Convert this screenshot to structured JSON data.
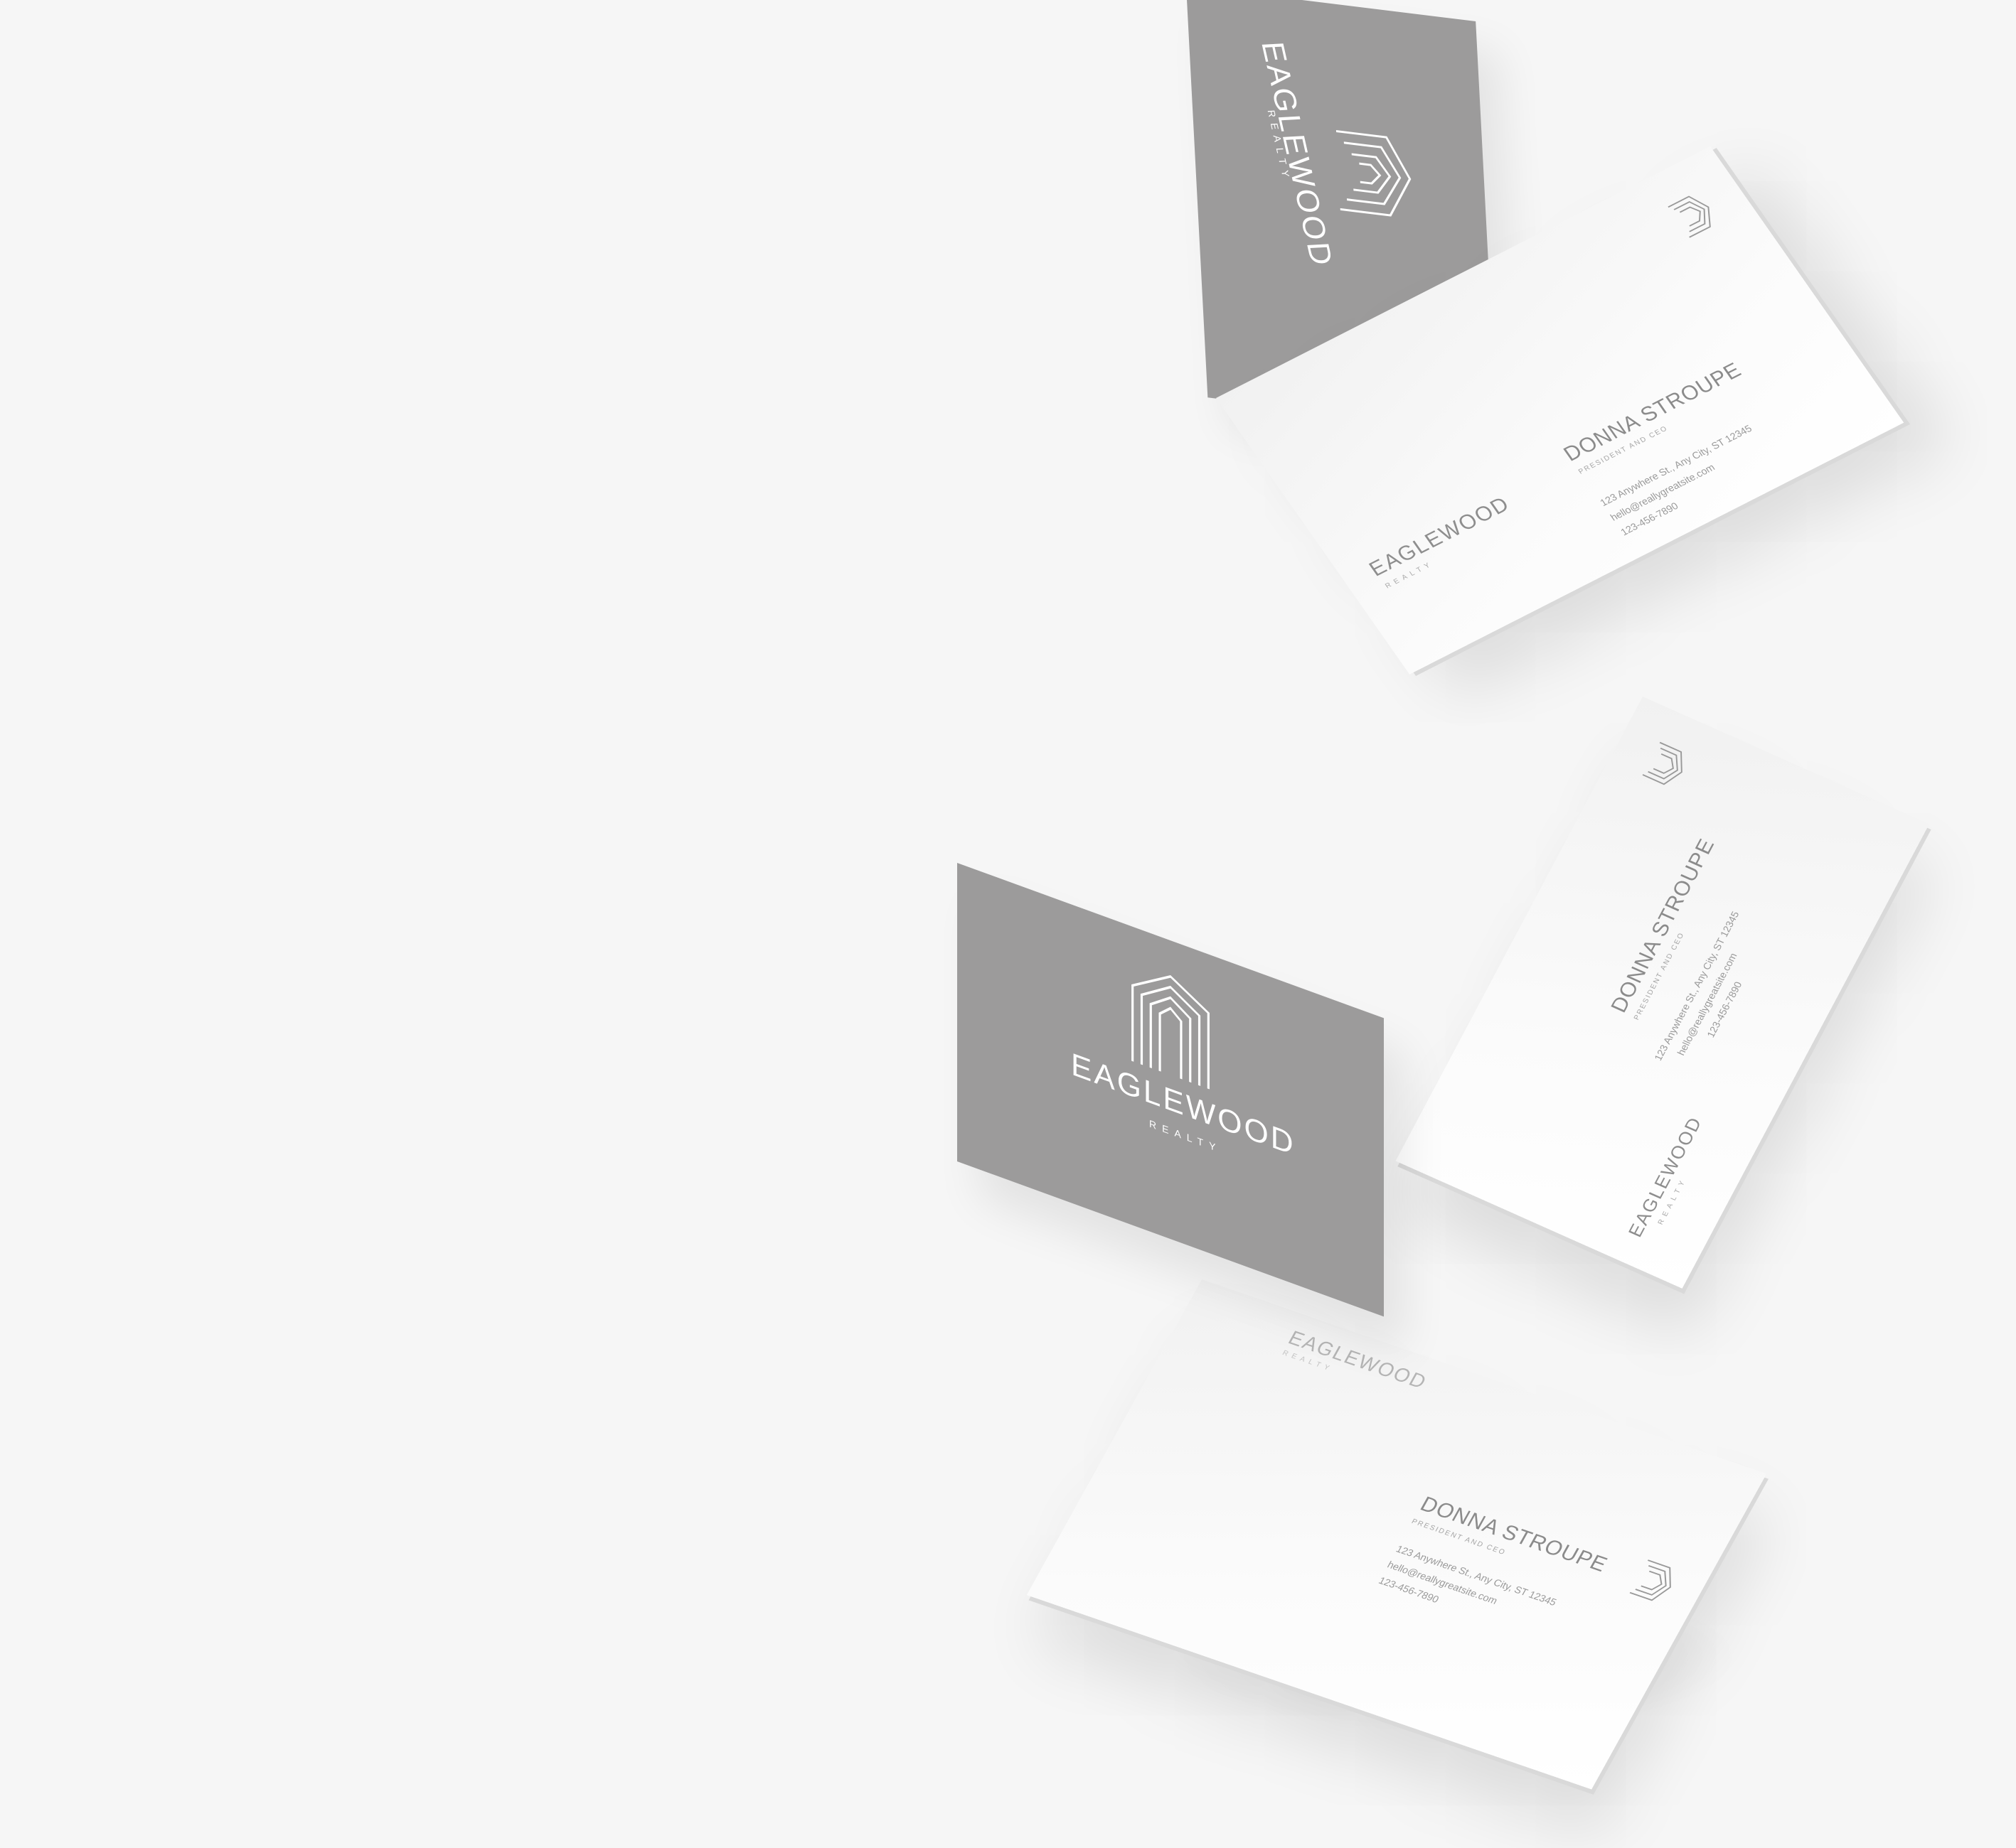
{
  "brand": {
    "name": "EAGLEWOOD",
    "sub": "REALTY",
    "logo_icon": "house-chevron-logo-icon"
  },
  "contact": {
    "name": "DONNA STROUPE",
    "role": "PRESIDENT AND CEO",
    "address": "123 Anywhere St., Any City, ST 12345",
    "email": "hello@reallygreatsite.com",
    "phone": "123-456-7890"
  },
  "colors": {
    "background": "#f6f6f6",
    "card_gray": "#9c9b9b",
    "card_white": "#fafafa",
    "text_gray": "#8b8b8b"
  }
}
